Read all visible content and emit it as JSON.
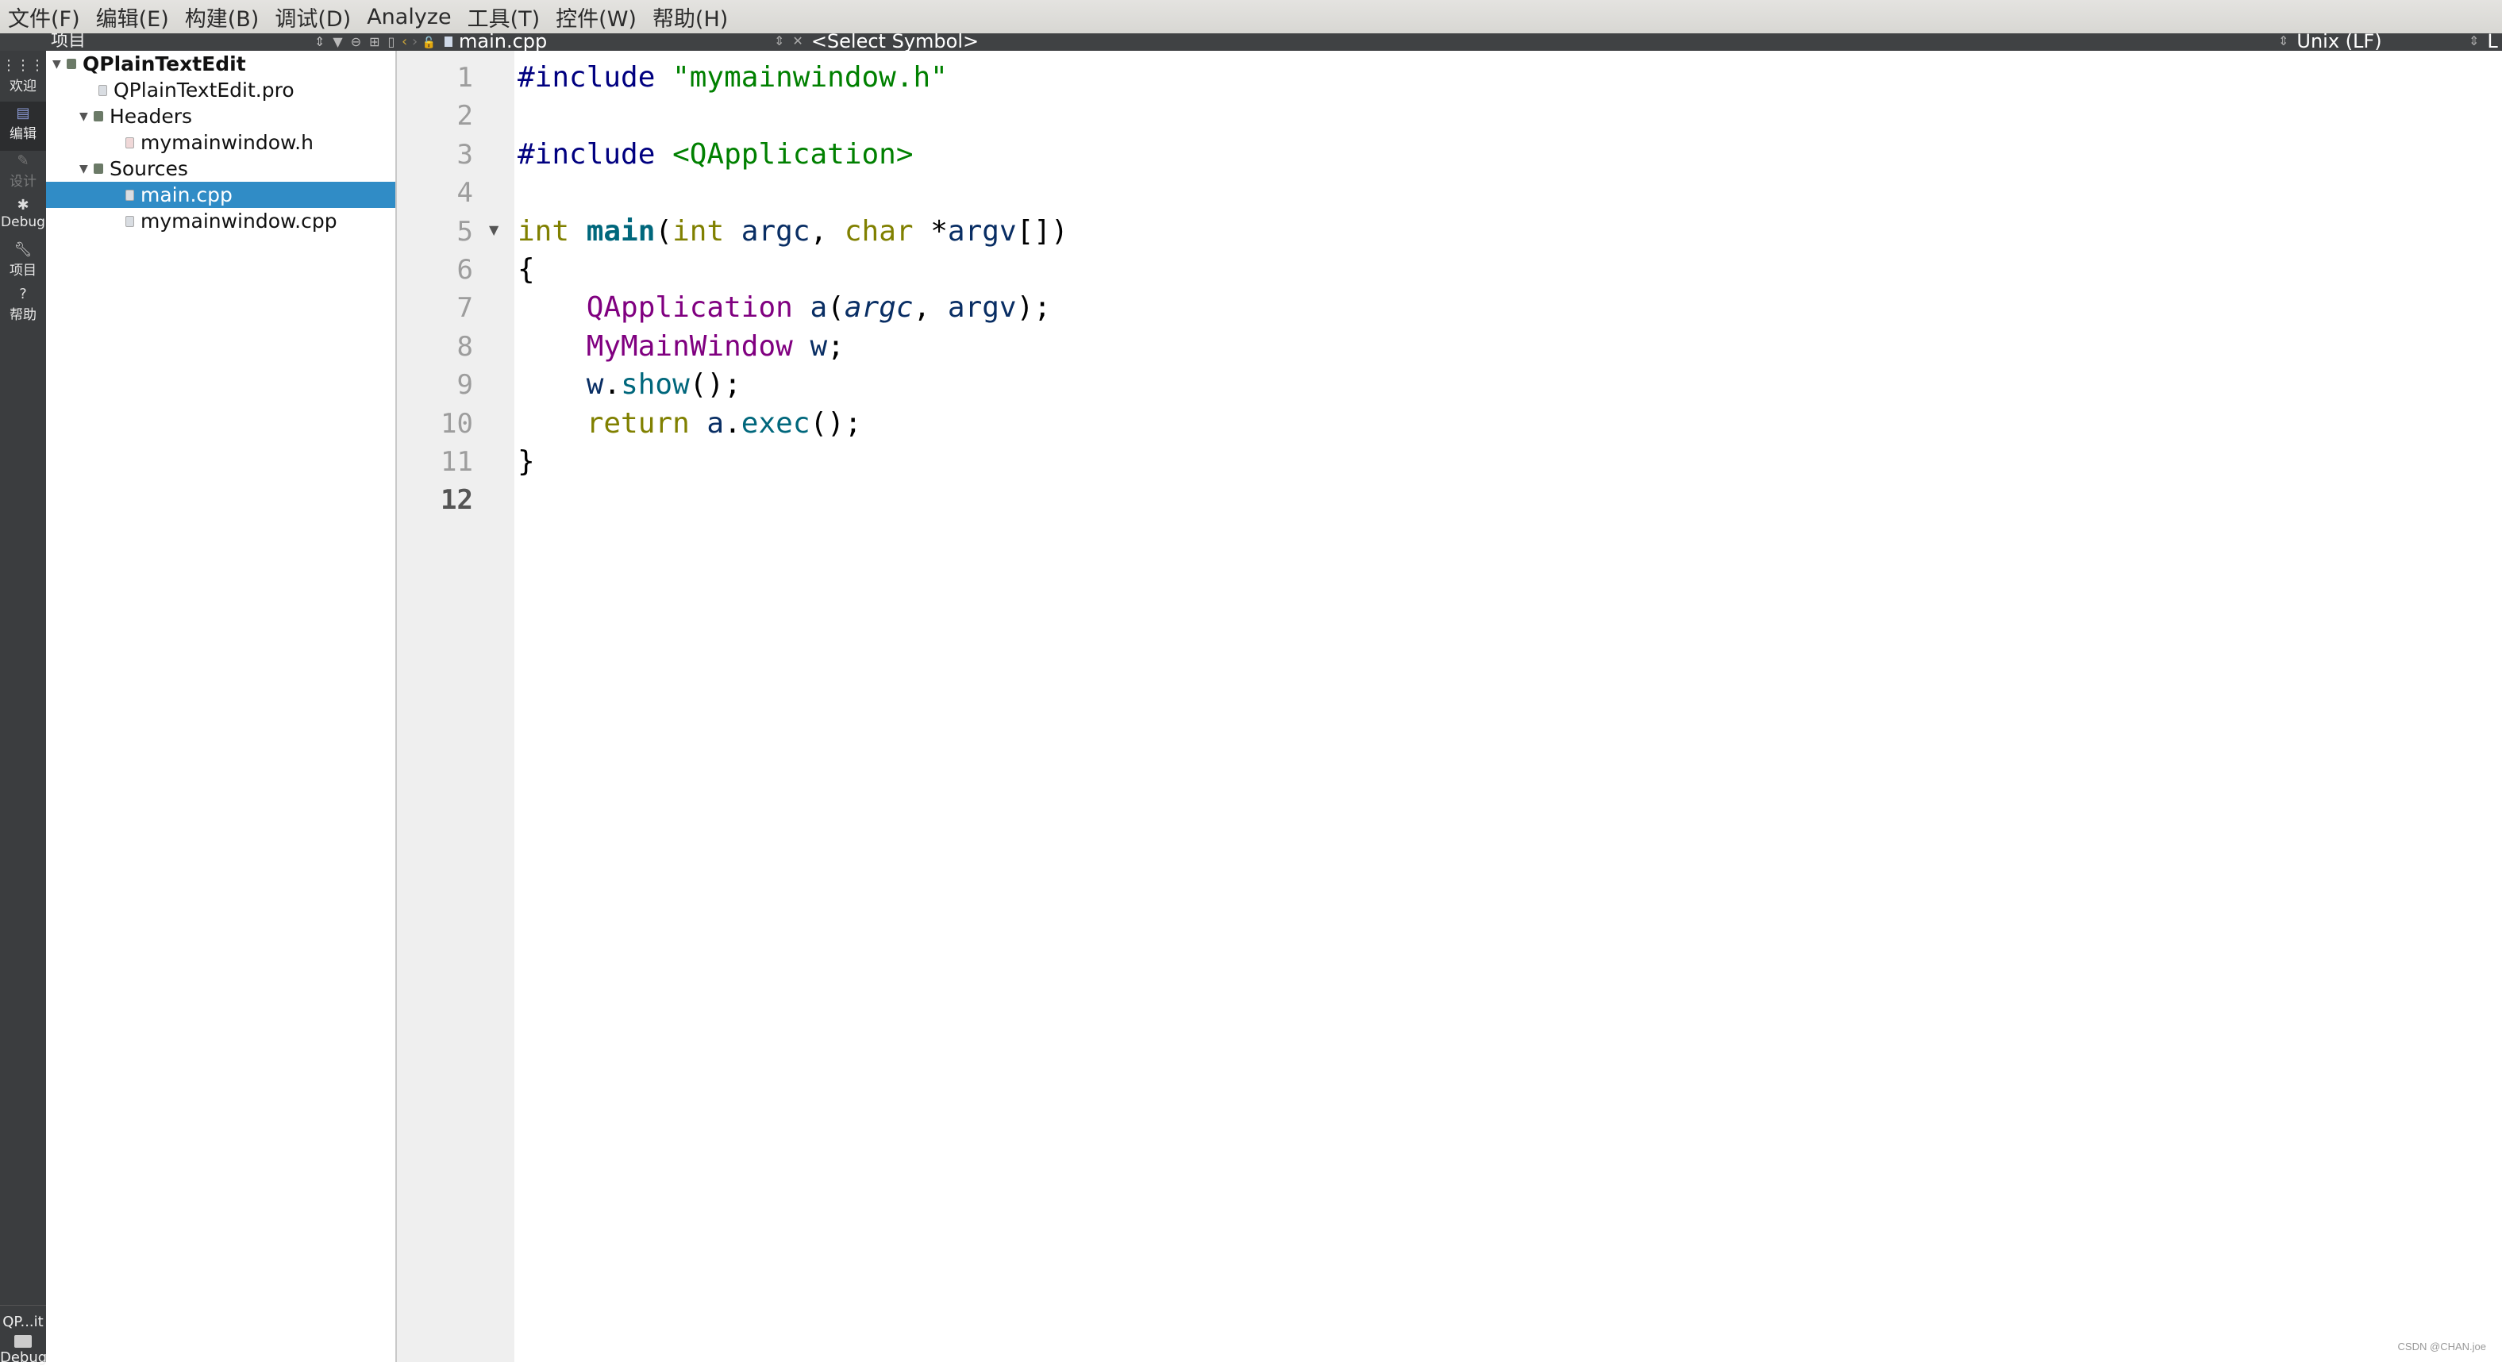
{
  "menubar": {
    "items": [
      "文件(F)",
      "编辑(E)",
      "构建(B)",
      "调试(D)",
      "Analyze",
      "工具(T)",
      "控件(W)",
      "帮助(H)"
    ]
  },
  "toolbar": {
    "project_pane_title": "项目",
    "current_file": "main.cpp",
    "symbol_selector": "<Select Symbol>",
    "line_ending": "Unix (LF)",
    "truncated_label": "L"
  },
  "modebar": {
    "modes": [
      {
        "label": "欢迎",
        "icon": "grid-icon",
        "state": "normal"
      },
      {
        "label": "编辑",
        "icon": "edit-doc-icon",
        "state": "active"
      },
      {
        "label": "设计",
        "icon": "pencil-icon",
        "state": "disabled"
      },
      {
        "label": "Debug",
        "icon": "bug-icon",
        "state": "normal"
      },
      {
        "label": "项目",
        "icon": "wrench-icon",
        "state": "normal"
      },
      {
        "label": "帮助",
        "icon": "help-icon",
        "state": "normal"
      }
    ],
    "kit": {
      "project": "QP...it",
      "build": "Debug"
    }
  },
  "project_tree": [
    {
      "label": "QPlainTextEdit",
      "level": 0,
      "expanded": true,
      "kind": "project",
      "bold": true
    },
    {
      "label": "QPlainTextEdit.pro",
      "level": 1,
      "kind": "pro-file"
    },
    {
      "label": "Headers",
      "level": 1,
      "expanded": true,
      "kind": "folder"
    },
    {
      "label": "mymainwindow.h",
      "level": 2,
      "kind": "header-file"
    },
    {
      "label": "Sources",
      "level": 1,
      "expanded": true,
      "kind": "folder"
    },
    {
      "label": "main.cpp",
      "level": 2,
      "kind": "source-file",
      "selected": true
    },
    {
      "label": "mymainwindow.cpp",
      "level": 2,
      "kind": "source-file"
    }
  ],
  "editor": {
    "current_line": 12,
    "lines": [
      {
        "n": "1",
        "tokens": [
          [
            "pp",
            "#include "
          ],
          [
            "str",
            "\"mymainwindow.h\""
          ]
        ]
      },
      {
        "n": "2",
        "tokens": []
      },
      {
        "n": "3",
        "tokens": [
          [
            "pp",
            "#include "
          ],
          [
            "str",
            "<QApplication>"
          ]
        ]
      },
      {
        "n": "4",
        "tokens": []
      },
      {
        "n": "5",
        "fold": true,
        "tokens": [
          [
            "kw",
            "int "
          ],
          [
            "fnb",
            "main"
          ],
          [
            "",
            "("
          ],
          [
            "kw",
            "int "
          ],
          [
            "var",
            "argc"
          ],
          [
            "",
            ", "
          ],
          [
            "kw",
            "char "
          ],
          [
            "",
            "*"
          ],
          [
            "var",
            "argv"
          ],
          [
            "",
            "[])"
          ]
        ]
      },
      {
        "n": "6",
        "tokens": [
          [
            "",
            "{"
          ]
        ]
      },
      {
        "n": "7",
        "tokens": [
          [
            "",
            "    "
          ],
          [
            "type",
            "QApplication "
          ],
          [
            "var",
            "a"
          ],
          [
            "",
            "("
          ],
          [
            "par",
            "argc"
          ],
          [
            "",
            ", "
          ],
          [
            "var",
            "argv"
          ],
          [
            "",
            ");"
          ]
        ]
      },
      {
        "n": "8",
        "tokens": [
          [
            "",
            "    "
          ],
          [
            "type",
            "MyMainWindow "
          ],
          [
            "var",
            "w"
          ],
          [
            "",
            ";"
          ]
        ]
      },
      {
        "n": "9",
        "tokens": [
          [
            "",
            "    "
          ],
          [
            "var",
            "w"
          ],
          [
            "",
            "."
          ],
          [
            "fn",
            "show"
          ],
          [
            "",
            "();"
          ]
        ]
      },
      {
        "n": "10",
        "tokens": [
          [
            "",
            "    "
          ],
          [
            "kw",
            "return "
          ],
          [
            "var",
            "a"
          ],
          [
            "",
            "."
          ],
          [
            "fn",
            "exec"
          ],
          [
            "",
            "();"
          ]
        ]
      },
      {
        "n": "11",
        "tokens": [
          [
            "",
            "}"
          ]
        ]
      },
      {
        "n": "12",
        "tokens": []
      }
    ]
  },
  "watermark": "CSDN @CHAN.joe"
}
